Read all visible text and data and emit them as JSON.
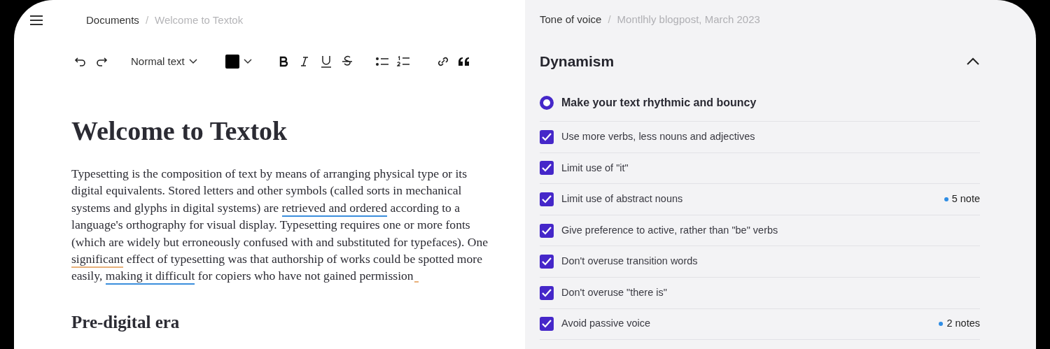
{
  "breadcrumb": {
    "parent": "Documents",
    "separator": "/",
    "current": "Welcome to Textok"
  },
  "toolbar": {
    "text_style": "Normal text"
  },
  "document": {
    "title": "Welcome to Textok",
    "paragraph": [
      {
        "text": "Typesetting is the composition of text by means of arranging physical type or its digital equivalents. Stored letters and other symbols (called sorts in mechanical systems and glyphs in digital systems) are "
      },
      {
        "text": "retrieved and ordered",
        "color": "#3b8fdd"
      },
      {
        "text": " according to a language's orthography for visual display. Typesetting requires one or more fonts (which are widely but erroneously confused with and substituted for typefaces). One "
      },
      {
        "text": "significant",
        "color": "#e8b07a"
      },
      {
        "text": " effect of typesetting was that authorship of works could be spotted more easily, "
      },
      {
        "text": "making it difficult",
        "color": "#3b8fdd"
      },
      {
        "text": " for copiers who have not gained permission"
      }
    ],
    "end_marker": true,
    "heading": "Pre-digital era"
  },
  "panel": {
    "breadcrumb": {
      "parent": "Tone of voice",
      "separator": "/",
      "current": "Montlhly blogpost, March 2023"
    },
    "section": {
      "title": "Dynamism",
      "expanded": true,
      "goal": {
        "label": "Make your text rhythmic and bouncy",
        "selected": true
      },
      "rules": [
        {
          "label": "Use more verbs, less nouns and adjectives",
          "checked": true
        },
        {
          "label": "Limit use of \"it\"",
          "checked": true
        },
        {
          "label": "Limit use of abstract nouns",
          "checked": true,
          "notes": "5 note"
        },
        {
          "label": "Give preference to active, rather than \"be\" verbs",
          "checked": true
        },
        {
          "label": "Don't overuse transition words",
          "checked": true
        },
        {
          "label": "Don't overuse \"there is\"",
          "checked": true
        },
        {
          "label": "Avoid passive voice",
          "checked": true,
          "notes": "2 notes"
        }
      ]
    }
  }
}
